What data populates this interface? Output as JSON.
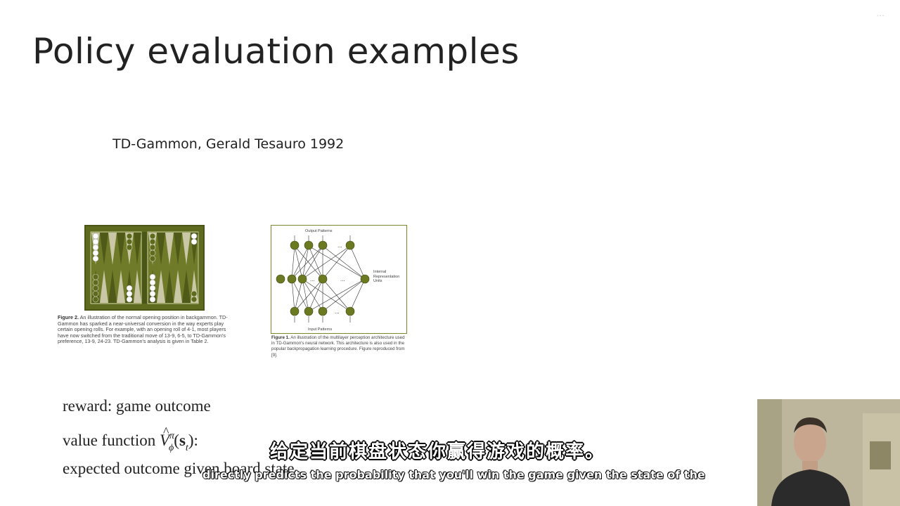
{
  "slide": {
    "title": "Policy evaluation examples",
    "citation": "TD-Gammon, Gerald Tesauro 1992",
    "watermark": "..."
  },
  "figures": {
    "backgammon": {
      "caption_label": "Figure 2.",
      "caption_text": "An illustration of the normal opening position in backgammon. TD-Gammon has sparked a near-universal conversion in the way experts play certain opening rolls. For example, with an opening roll of 4-1, most players have now switched from the traditional move of 13-9, 6-5, to TD-Gammon's preference, 13-9, 24-23. TD-Gammon's analysis is given in Table 2."
    },
    "network": {
      "output_label": "Output Patterns",
      "hidden_label": "Internal Representation Units",
      "input_label": "Input Patterns",
      "dots": "...",
      "caption_label": "Figure 1.",
      "caption_text": "An illustration of the multilayer perception architecture used in TD-Gammon's neural network. This architecture is also used in the popular backpropagation learning procedure. Figure reproduced from [9]."
    }
  },
  "math": {
    "reward": "reward:  game outcome",
    "value_prefix": "value function ",
    "value_V": "V",
    "value_sup": "π",
    "value_sub": "ϕ",
    "value_arg_open": "(",
    "value_arg_s": "s",
    "value_arg_t": "t",
    "value_arg_close": "):",
    "expected": "expected outcome given board state"
  },
  "subtitles": {
    "chinese": "给定当前棋盘状态你赢得游戏的概率。",
    "english": "directly predicts the probability that you'll win the game given the state of the"
  },
  "colors": {
    "board_green": "#5e6a1e",
    "node_green": "#6b7a20",
    "subtitle_text": "#ffffff",
    "subtitle_outline": "#000000"
  }
}
